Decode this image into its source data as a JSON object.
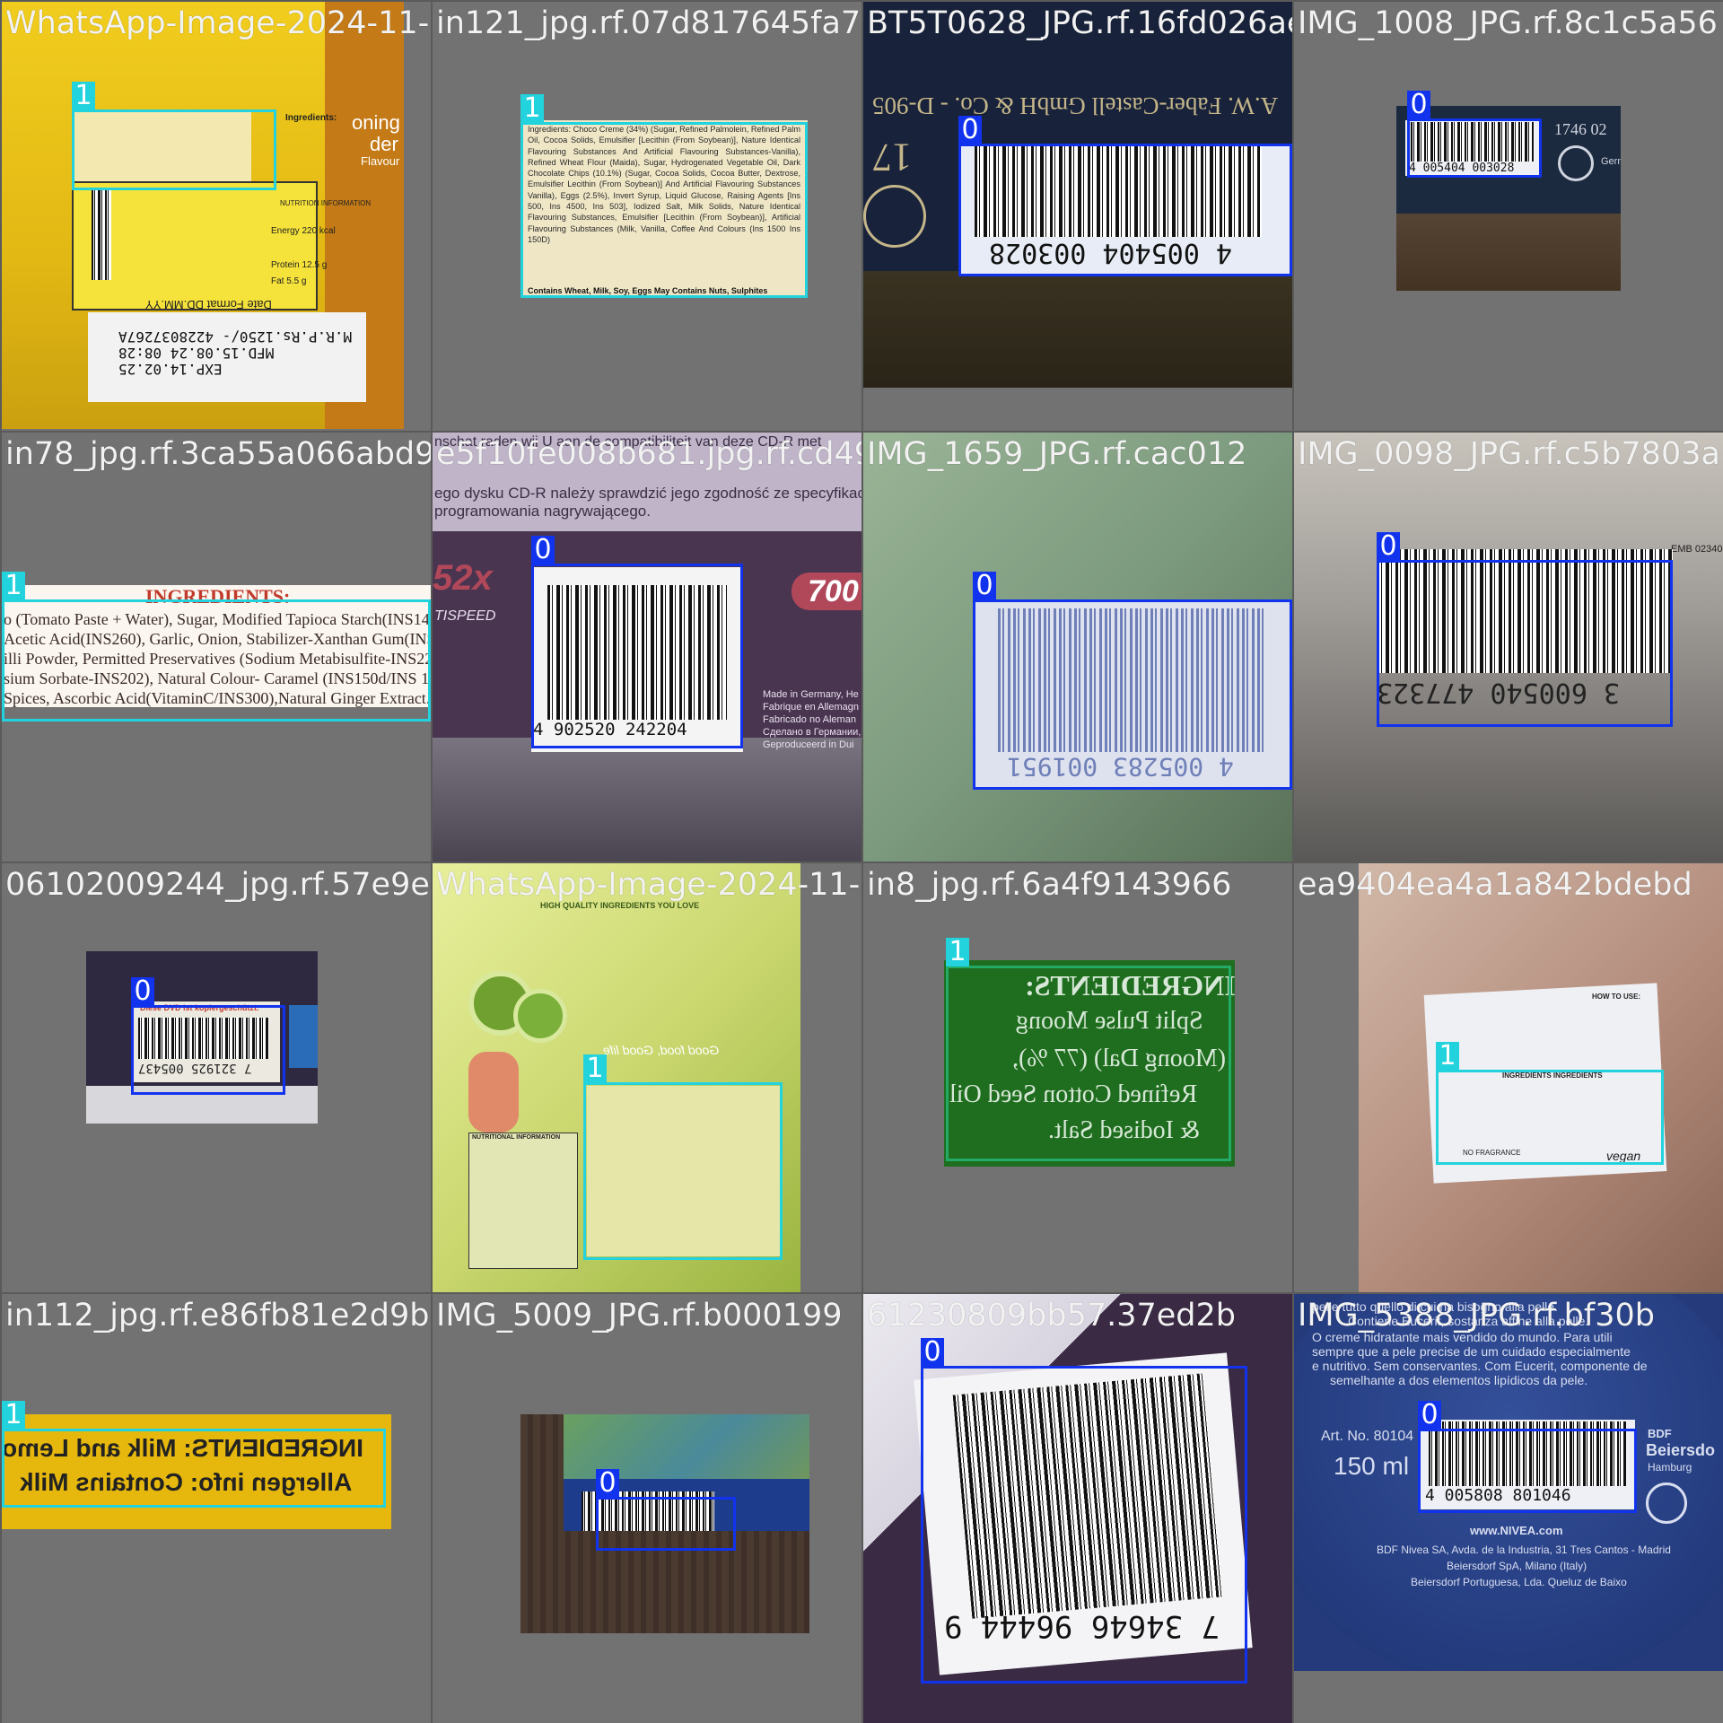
{
  "class_colors": {
    "class_0": "#1133ee",
    "class_1": "#22d3dd"
  },
  "tiles": [
    {
      "title": "WhatsApp-Image-2024-11-16-at-20-28-06_a8",
      "boxes": [
        {
          "label": "1"
        }
      ],
      "text": {
        "ingredients_heading": "Ingredients:",
        "date_format": "Date Format DD.MM.YY",
        "print_line1": "M.R.P.Rs.1250/- 4228037267A",
        "print_line2": "MFD.15.08.24 08:28",
        "print_line3": "EXP.14.02.25",
        "flavour_1": "oning",
        "flavour_2": "der",
        "flavour_3": "Flavour",
        "nutrition": "NUTRITION INFORMATION",
        "energy": "Energy 220 kcal",
        "protein": "Protein 12.5 g",
        "fat": "Fat 5.5 g"
      }
    },
    {
      "title": "in121_jpg.rf.07d817645fa793",
      "boxes": [
        {
          "label": "1"
        }
      ],
      "text": {
        "ingredients": "Ingredients: Choco Creme (34%) (Sugar, Refined Palmolein, Refined Palm Oil, Cocoa Solids, Emulsifier [Lecithin (From Soybean)], Nature Identical Flavouring Substances And Artificial Flavouring Substances-Vanilla), Refined Wheat Flour (Maida), Sugar, Hydrogenated Vegetable Oil, Dark Chocolate Chips (10.1%) (Sugar, Cocoa Solids, Cocoa Butter, Dextrose, Emulsifier Lecithin (From Soybean)] And Artificial Flavouring Substances Vanilla), Eggs (2.5%), Invert Syrup, Liquid Glucose, Raising Agents [Ins 500, Ins 4500, Ins 503], Iodized Salt, Milk Solids, Nature Identical Flavouring Substances, Emulsifier [Lecithin (From Soybean)], Artificial Flavouring Substances (Milk, Vanilla, Coffee And Colours (Ins 1500 Ins 150D)",
        "contains": "Contains Wheat, Milk, Soy, Eggs May Contains Nuts, Sulphites"
      }
    },
    {
      "title": "BT5T0628_JPG.rf.16fd026ae72270",
      "boxes": [
        {
          "label": "0"
        }
      ],
      "text": {
        "maker": "A.W. Faber-Castell GmbH & Co. - D-905",
        "code": "17",
        "barcode_digits": "4 005404 003028"
      }
    },
    {
      "title": "IMG_1008_JPG.rf.8c1c5a56",
      "boxes": [
        {
          "label": "0"
        }
      ],
      "text": {
        "ref": "1746 02",
        "barcode_digits": "4 005404 003028",
        "side": "Germ"
      }
    },
    {
      "title": "in78_jpg.rf.3ca55a066abd96",
      "boxes": [
        {
          "label": "1"
        }
      ],
      "text": {
        "heading": "INGREDIENTS:",
        "line1": "o (Tomato Paste + Water), Sugar, Modified Tapioca Starch(INS14",
        "line2": "Acetic Acid(INS260), Garlic, Onion, Stabilizer-Xanthan Gum(INS41",
        "line3": "illi Powder, Permitted Preservatives (Sodium Metabisulfite-INS223",
        "line4": "sium Sorbate-INS202), Natural Colour- Caramel (INS150d/INS 15",
        "line5": "Spices, Ascorbic Acid(VitaminC/INS300),Natural Ginger Extract."
      }
    },
    {
      "title": "e5f10fe008b681.jpg.rf.cd4978",
      "boxes": [
        {
          "label": "0"
        }
      ],
      "text": {
        "top1": "nschat raden wij U aan de compatibiliteit van deze CD-R met",
        "top2": "ego dysku CD-R należy sprawdzić jego zgodność ze specyfikacj",
        "top3": "programowania nagrywającego.",
        "speed_x": "52x",
        "speed_word": "TISPEED",
        "capacity": "700",
        "barcode_digits": "4 902520 242204",
        "made1": "Made in Germany, He",
        "made2": "Fabrique en Allemagn",
        "made3": "Fabricado no Aleman",
        "made4": "Сделано в Германии,",
        "made5": "Geproduceerd in Dui"
      }
    },
    {
      "title": "IMG_1659_JPG.rf.cac012",
      "boxes": [
        {
          "label": "0"
        }
      ],
      "text": {
        "barcode_digits": "4 005283 001951"
      }
    },
    {
      "title": "IMG_0098_JPG.rf.c5b7803a",
      "boxes": [
        {
          "label": "0"
        }
      ],
      "text": {
        "code": "EMB 02340",
        "barcode_digits": "3 600540 477323"
      }
    },
    {
      "title": "06102009244_jpg.rf.57e9e0",
      "boxes": [
        {
          "label": "0"
        }
      ],
      "text": {
        "warning": "Diese DVD ist kopiergeschützt.",
        "barcode_digits": "7 321925 005437"
      }
    },
    {
      "title": "WhatsApp-Image-2024-11-16-at-20-26-13_74",
      "boxes": [
        {
          "label": "1"
        }
      ],
      "text": {
        "banner": "Good food, Good life",
        "badge": "HIGH QUALITY INGREDIENTS YOU LOVE",
        "nutrition": "NUTRITIONAL INFORMATION"
      }
    },
    {
      "title": "in8_jpg.rf.6a4f9143966",
      "boxes": [
        {
          "label": "1"
        }
      ],
      "text": {
        "heading": "INGREDIENTS:",
        "line1": "Split Pulse Moong",
        "line2": "(Moong Dal) (77 %),",
        "line3": "Refined Cotton Seed Oil",
        "line4": "& Iodised Salt."
      }
    },
    {
      "title": "ea9404ea4a1a842bdebd",
      "boxes": [
        {
          "label": "1"
        }
      ],
      "text": {
        "howto": "HOW TO USE:",
        "ingredients": "INGREDIENTS INGREDIENTS",
        "nofrag": "NO FRAGRANCE",
        "vegan": "vegan"
      }
    },
    {
      "title": "in112_jpg.rf.e86fb81e2d9b0",
      "boxes": [
        {
          "label": "1"
        }
      ],
      "text": {
        "line1": "INGREDIENTS: Milk and Lemo",
        "line2": "Allergen info: Contains Milk"
      }
    },
    {
      "title": "IMG_5009_JPG.rf.b000199",
      "boxes": [
        {
          "label": "0"
        }
      ],
      "text": {}
    },
    {
      "title": "61230809bb57.37ed2b",
      "boxes": [
        {
          "label": "0"
        }
      ],
      "text": {
        "barcode_digits": "7 34646 96444 9"
      }
    },
    {
      "title": "IMG_5388_JPG.rf.bf30b",
      "boxes": [
        {
          "label": "0"
        }
      ],
      "text": {
        "top1": "pelle tutto quello di cui ha bisogno alla pelle.",
        "top2": "Contiene Eucerit, sostanza affine alla pelle.",
        "top3": "O creme hidratante mais vendido do mundo. Para utili",
        "top4": "sempre que a pele precise de um cuidado especialmente",
        "top5": "e nutritivo. Sem conservantes. Com Eucerit, componente de",
        "top6": "semelhante a dos elementos lipídicos da pele.",
        "art": "Art. No. 80104",
        "volume": "150 ml",
        "brand": "BDF",
        "brand2": "Beiersdo",
        "city": "Hamburg",
        "barcode_digits": "4 005808 801046",
        "url": "www.NIVEA.com",
        "addr1": "BDF Nivea SA, Avda. de la Industria, 31 Tres Cantos - Madrid",
        "addr2": "Beiersdorf SpA, Milano (Italy)",
        "addr3": "Beiersdorf Portuguesa, Lda. Queluz de Baixo"
      }
    }
  ]
}
